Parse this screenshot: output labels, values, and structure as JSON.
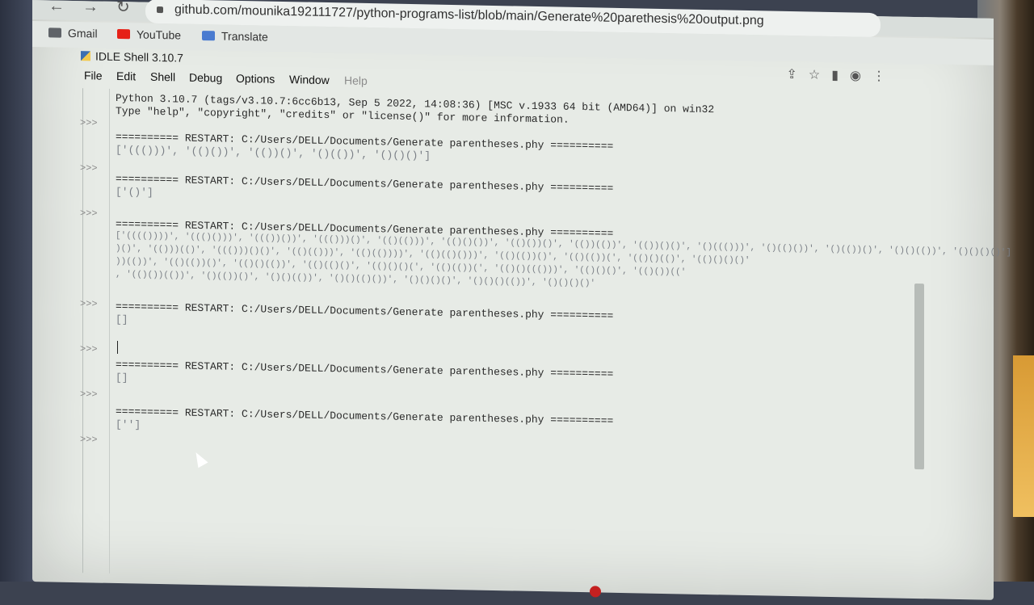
{
  "browser": {
    "url": "github.com/mounika192111727/python-programs-list/blob/main/Generate%20parethesis%20output.png",
    "bookmarks": [
      {
        "label": "Gmail",
        "icon": "gmail-icon",
        "color": "#5f6368"
      },
      {
        "label": "YouTube",
        "icon": "youtube-icon",
        "color": "#e62117"
      },
      {
        "label": "Translate",
        "icon": "translate-icon",
        "color": "#4a7bd0"
      }
    ]
  },
  "idle": {
    "title": "IDLE Shell 3.10.7",
    "menu": [
      "File",
      "Edit",
      "Shell",
      "Debug",
      "Options",
      "Window",
      "Help"
    ],
    "prompt": ">>>",
    "lines": {
      "banner1": "Python 3.10.7 (tags/v3.10.7:6cc6b13, Sep  5 2022, 14:08:36) [MSC v.1933 64 bit (AMD64)] on win32",
      "banner2": "Type \"help\", \"copyright\", \"credits\" or \"license()\" for more information.",
      "restart": "========== RESTART: C:/Users/DELL/Documents/Generate parentheses.phy ==========",
      "out1": "['((()))', '(()())', '(())()', '()(())', '()()()']",
      "out2": "['()']",
      "out3a": "['(((())))', '((()()))', '((())())', '((()))()', '(()(()))', '(()()())', '(()())()', '(())(())', '(())()()', '()((()))', '()(()())', '()(())()', '()()(())', '()()()()']",
      "out3b": ")()', '(()))(()', '((()))()()', '(()(()))', '(()(())))', '(()(()()))', '(()(())()', '(()(())(', '(()()(()', '(()()()()'",
      "out3c": "))(())', '(()(())()', '(()()(())', '(()(()()', '(()()()(', '(()(())(', '(()()((()))', '(()()()', '(()())(('",
      "out3d": ", '(()())(())', '()(())()', '()()(())', '()()(()())', '()()()()', '()()()(())', '()()()()'",
      "out4": "[]",
      "out5": "[]",
      "out6": "['']"
    }
  }
}
